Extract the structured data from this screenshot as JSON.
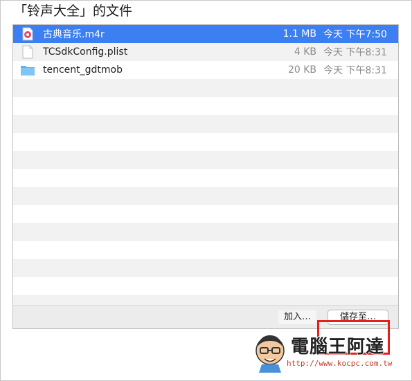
{
  "window": {
    "title": "「铃声大全」的文件"
  },
  "files": [
    {
      "name": "古典音乐.m4r",
      "size": "1.1 MB",
      "date": "今天 下午7:50",
      "icon": "music-file-icon",
      "selected": true
    },
    {
      "name": "TCSdkConfig.plist",
      "size": "4 KB",
      "date": "今天 下午8:31",
      "icon": "document-file-icon",
      "selected": false
    },
    {
      "name": "tencent_gdtmob",
      "size": "20 KB",
      "date": "今天 下午8:31",
      "icon": "folder-icon",
      "selected": false
    }
  ],
  "toolbar": {
    "add_label": "加入…",
    "save_label": "儲存至…"
  },
  "watermark": {
    "brand": "電腦王阿達",
    "url": "http://www.kocpc.com.tw"
  },
  "colors": {
    "selection": "#3b7ff2",
    "highlight": "#e81d1d",
    "folder": "#5bb4f0"
  }
}
